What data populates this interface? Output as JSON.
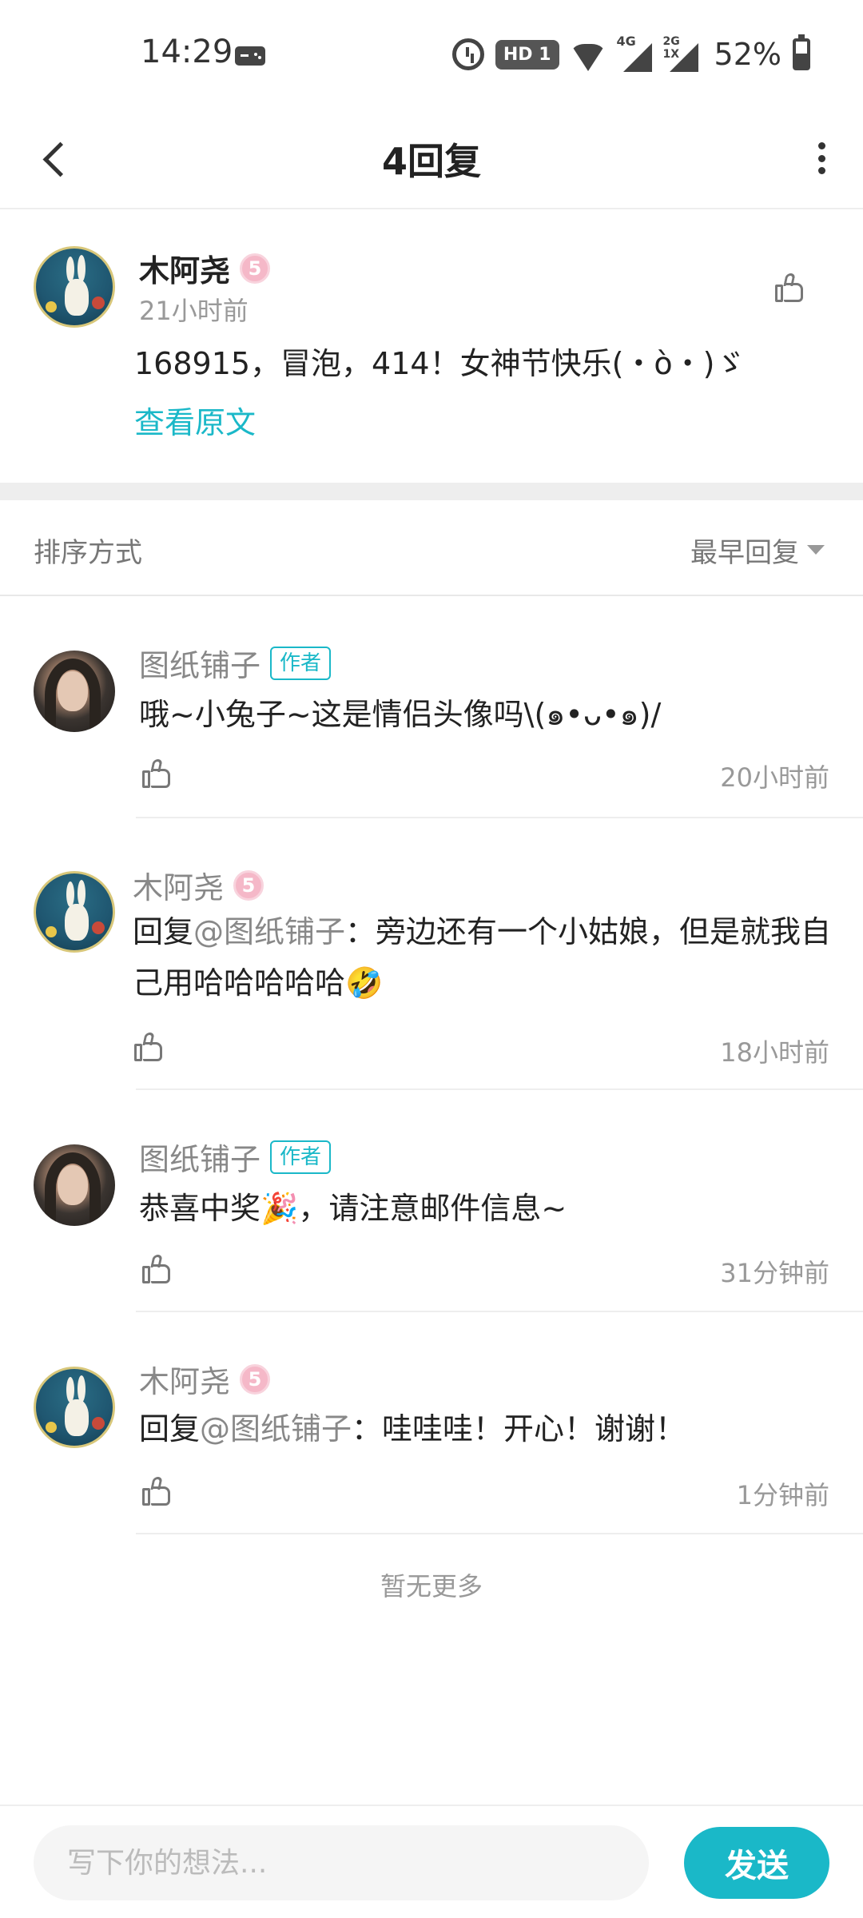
{
  "status_bar": {
    "time": "14:29",
    "hd_label": "HD 1",
    "signal1_label": "4G",
    "signal2_label": "2G 1X",
    "battery_percent": "52%",
    "battery_level": 0.52
  },
  "header": {
    "title": "4回复"
  },
  "post": {
    "author": "木阿尧",
    "level": "5",
    "time": "21小时前",
    "content": "168915，冒泡，414！女神节快乐(・ὸ・)ゞ",
    "view_original": "查看原文"
  },
  "sort": {
    "label": "排序方式",
    "value": "最早回复"
  },
  "replies": [
    {
      "author": "图纸铺子",
      "badge": "作者",
      "text": "哦~小兔子~这是情侣头像吗\\(๑•ᴗ•๑)/",
      "time": "20小时前"
    },
    {
      "author": "木阿尧",
      "level": "5",
      "reply_prefix": "回复",
      "mention": "@图纸铺子",
      "text": "：旁边还有一个小姑娘，但是就我自己用哈哈哈哈哈🤣",
      "time": "18小时前"
    },
    {
      "author": "图纸铺子",
      "badge": "作者",
      "text": "恭喜中奖🎉，请注意邮件信息~",
      "time": "31分钟前"
    },
    {
      "author": "木阿尧",
      "level": "5",
      "reply_prefix": "回复",
      "mention": "@图纸铺子",
      "text": "：哇哇哇！开心！谢谢！",
      "time": "1分钟前"
    }
  ],
  "no_more": "暂无更多",
  "bottom": {
    "input_placeholder": "写下你的想法...",
    "send_label": "发送"
  },
  "colors": {
    "accent": "#1ab8c8",
    "divider": "#eeeeee",
    "secondary_text": "#999999"
  },
  "icons": [
    "back-arrow-icon",
    "more-vertical-icon",
    "thumbs-up-icon",
    "alarm-icon",
    "wifi-icon",
    "signal-icon",
    "battery-icon",
    "gamepad-icon",
    "dropdown-caret-icon"
  ]
}
